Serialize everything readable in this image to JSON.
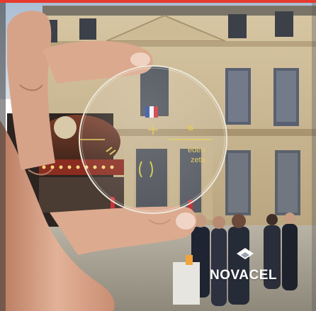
{
  "image": {
    "watermark": {
      "brand": "NOVACEL",
      "logo_icon": "novacel-diamond-logo-icon"
    },
    "lens_markings": {
      "line1": "eden",
      "line2": "zeta",
      "mark_letter": "G"
    },
    "colors": {
      "top_border": "#e63a2e",
      "stone": "#c9b48c",
      "sky": "#b9c8d8",
      "skin": "#d9a68a",
      "lens_marking": "#e4cf6a",
      "watermark": "#ffffff"
    }
  }
}
